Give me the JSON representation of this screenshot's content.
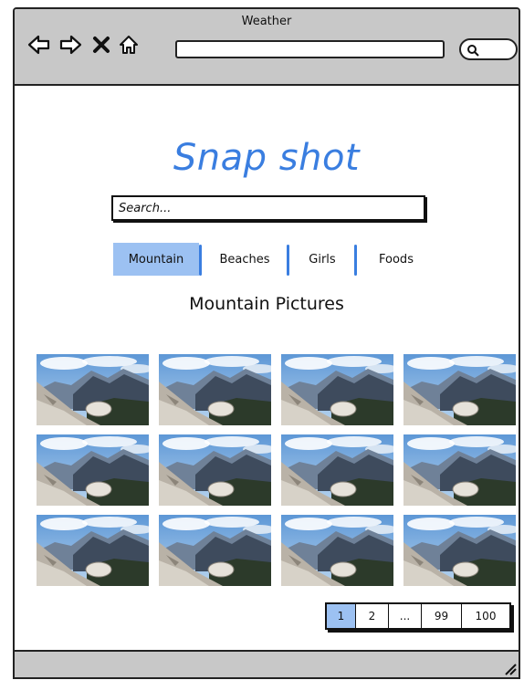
{
  "window": {
    "title": "Weather"
  },
  "browser": {
    "nav_icons": [
      "back-arrow-icon",
      "forward-arrow-icon",
      "close-x-icon",
      "home-icon"
    ],
    "address_value": ""
  },
  "brand": {
    "title": "Snap shot",
    "color": "#3a7ee0"
  },
  "search": {
    "placeholder": "Search..."
  },
  "tabs": [
    {
      "label": "Mountain",
      "active": true
    },
    {
      "label": "Beaches",
      "active": false
    },
    {
      "label": "Girls",
      "active": false
    },
    {
      "label": "Foods",
      "active": false
    }
  ],
  "gallery": {
    "title": "Mountain Pictures",
    "rows": 3,
    "cols": 4,
    "image": "mountain-landscape-photo"
  },
  "pagination": {
    "pages": [
      "1",
      "2",
      "...",
      "99",
      "100"
    ],
    "current": "1"
  },
  "colors": {
    "accent": "#3a7ee0",
    "highlight": "#9cc1f2",
    "chrome": "#c8c8c8"
  }
}
